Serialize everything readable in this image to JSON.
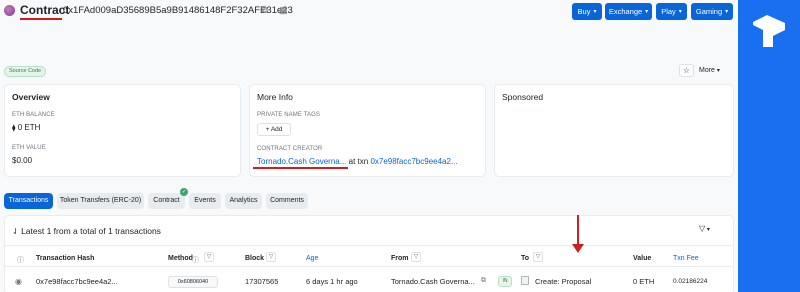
{
  "header": {
    "title": "Contract",
    "address": "0x1FAd009aD35689B5a9B91486148F2F32AFE31e23",
    "buttons": [
      {
        "label": "Buy"
      },
      {
        "label": "Exchange"
      },
      {
        "label": "Play"
      },
      {
        "label": "Gaming"
      }
    ]
  },
  "source_code_badge": "Source Code",
  "more_label": "More",
  "overview": {
    "title": "Overview",
    "eth_balance_label": "ETH BALANCE",
    "eth_balance_value": "0 ETH",
    "eth_value_label": "ETH VALUE",
    "eth_value_value": "$0.00"
  },
  "more_info": {
    "title": "More Info",
    "private_tags_label": "PRIVATE NAME TAGS",
    "add_label": "+ Add",
    "creator_label": "CONTRACT CREATOR",
    "creator_name": "Tornado.Cash Governa...",
    "at_txn": "at txn",
    "creator_txn": "0x7e98facc7bc9ee4a2..."
  },
  "sponsored": {
    "title": "Sponsored"
  },
  "tabs": [
    {
      "label": "Transactions",
      "active": true
    },
    {
      "label": "Token Transfers (ERC-20)",
      "active": false
    },
    {
      "label": "Contract",
      "active": false
    },
    {
      "label": "Events",
      "active": false
    },
    {
      "label": "Analytics",
      "active": false
    },
    {
      "label": "Comments",
      "active": false
    }
  ],
  "table": {
    "summary": "Latest 1 from a total of 1 transactions",
    "headers": {
      "hash": "Transaction Hash",
      "method": "Method",
      "block": "Block",
      "age": "Age",
      "from": "From",
      "to": "To",
      "value": "Value",
      "fee": "Txn Fee"
    },
    "rows": [
      {
        "hash": "0x7e98facc7bc9ee4a2...",
        "method": "0x60806040",
        "block": "17307565",
        "age": "6 days 1 hr ago",
        "from": "Tornado.Cash Governa...",
        "direction": "IN",
        "to": "Create: Proposal",
        "value": "0 ETH",
        "fee": "0.02186224"
      }
    ]
  },
  "colors": {
    "primary": "#0a66d8",
    "brand_strip": "#1a6ef0",
    "annotation_red": "#d0201d"
  }
}
